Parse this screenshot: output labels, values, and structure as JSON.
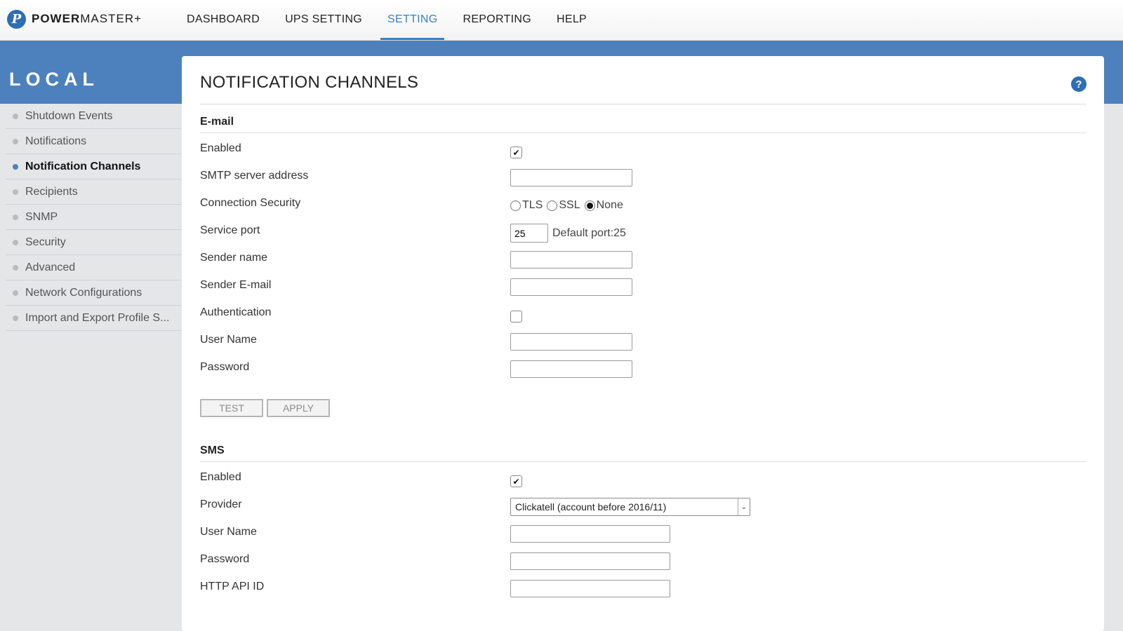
{
  "app": {
    "logo_glyph": "P",
    "brand_bold": "POWER",
    "brand_rest": "MASTER+"
  },
  "nav": {
    "items": [
      {
        "label": "DASHBOARD"
      },
      {
        "label": "UPS SETTING"
      },
      {
        "label": "SETTING"
      },
      {
        "label": "REPORTING"
      },
      {
        "label": "HELP"
      }
    ],
    "active": "SETTING"
  },
  "sidebar": {
    "title": "LOCAL",
    "items": [
      {
        "label": "Shutdown Events"
      },
      {
        "label": "Notifications"
      },
      {
        "label": "Notification Channels"
      },
      {
        "label": "Recipients"
      },
      {
        "label": "SNMP"
      },
      {
        "label": "Security"
      },
      {
        "label": "Advanced"
      },
      {
        "label": "Network Configurations"
      },
      {
        "label": "Import and Export Profile S..."
      }
    ],
    "active": "Notification Channels"
  },
  "page": {
    "title": "NOTIFICATION CHANNELS",
    "help_glyph": "?"
  },
  "email": {
    "section_title": "E-mail",
    "enabled_label": "Enabled",
    "enabled": true,
    "smtp_label": "SMTP server address",
    "smtp_value": "",
    "security_label": "Connection Security",
    "security_options": [
      "TLS",
      "SSL",
      "None"
    ],
    "security_selected": "None",
    "port_label": "Service port",
    "port_value": "25",
    "port_hint": "Default port:25",
    "sender_name_label": "Sender name",
    "sender_name_value": "",
    "sender_email_label": "Sender E-mail",
    "sender_email_value": "",
    "auth_label": "Authentication",
    "auth": false,
    "username_label": "User Name",
    "username_value": "",
    "password_label": "Password",
    "password_value": "",
    "test_label": "TEST",
    "apply_label": "APPLY"
  },
  "sms": {
    "section_title": "SMS",
    "enabled_label": "Enabled",
    "enabled": true,
    "provider_label": "Provider",
    "provider_value": "Clickatell (account before 2016/11)",
    "username_label": "User Name",
    "username_value": "",
    "password_label": "Password",
    "password_value": "",
    "api_label": "HTTP API ID",
    "api_value": ""
  },
  "icons": {
    "check": "✔",
    "chevron": "⌄"
  },
  "colors": {
    "accent": "#3a7fc3",
    "band": "#4d81bd",
    "logo": "#2f6db5"
  }
}
